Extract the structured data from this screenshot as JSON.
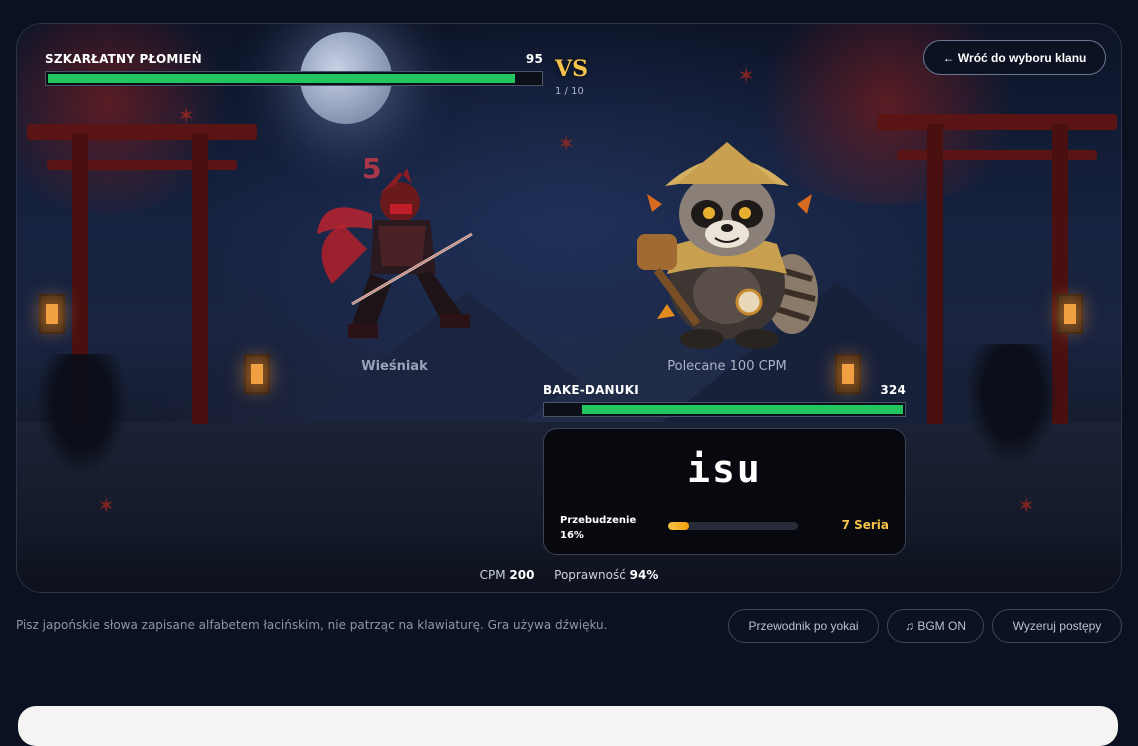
{
  "player": {
    "name": "SZKARŁATNY PŁOMIEŃ",
    "hp": 95,
    "hp_fraction": 0.95,
    "rank_label": "Wieśniak",
    "combo_count": "5"
  },
  "versus": {
    "vs_label": "VS",
    "round_label": "1 / 10"
  },
  "enemy": {
    "name": "BAKE-DANUKI",
    "hp": 324,
    "hp_fraction": 0.9,
    "subtitle": "Polecane 100 CPM"
  },
  "back_button": {
    "label": "← Wróć do wyboru klanu"
  },
  "typing": {
    "word": "isu",
    "awakening_label": "Przebudzenie",
    "awakening_value": "16%",
    "awakening_fraction": 0.16,
    "streak_label": "7 Seria"
  },
  "stats": {
    "cpm_label": "CPM",
    "cpm_value": "200",
    "accuracy_label": "Poprawność",
    "accuracy_value": "94%"
  },
  "footer": {
    "hint": "Pisz japońskie słowa zapisane alfabetem łacińskim, nie patrząc na klawiaturę. Gra używa dźwięku.",
    "guide_button": "Przewodnik po yokai",
    "bgm_button": "♫ BGM ON",
    "reset_button": "Wyzeruj postępy"
  },
  "colors": {
    "hp_green": "#22c55e",
    "accent_gold": "#f5c24a",
    "background": "#0b1120"
  },
  "icons": {
    "back": "arrow-left-icon",
    "bgm": "music-note-icon"
  }
}
